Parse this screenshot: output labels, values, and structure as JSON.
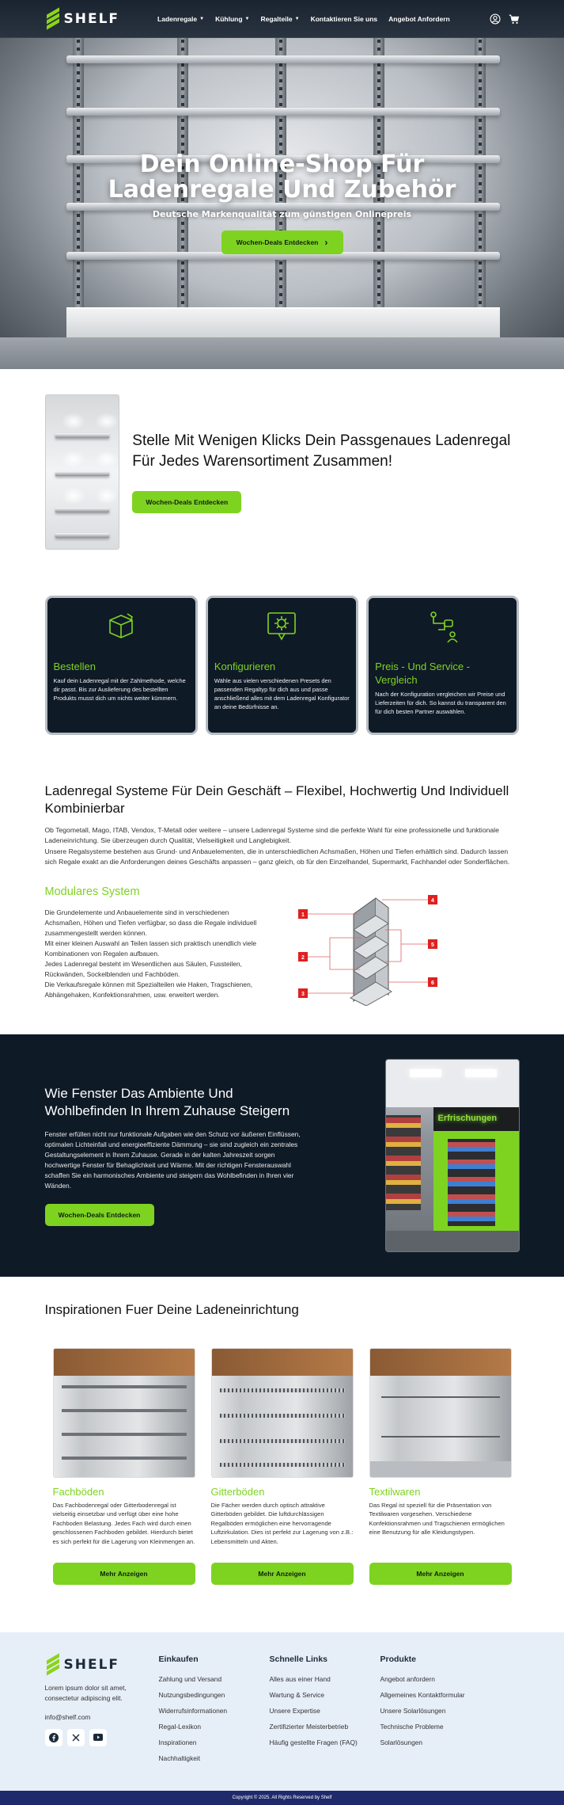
{
  "brand": {
    "name": "SHELF",
    "accent": "#7ed321",
    "dark": "#0f1a27"
  },
  "nav": {
    "items": [
      {
        "label": "Ladenregale",
        "dropdown": true
      },
      {
        "label": "Kühlung",
        "dropdown": true
      },
      {
        "label": "Regalteile",
        "dropdown": true
      },
      {
        "label": "Kontaktieren Sie uns",
        "dropdown": false
      },
      {
        "label": "Angebot Anfordern",
        "dropdown": false
      }
    ],
    "icons": [
      "user-icon",
      "cart-icon"
    ]
  },
  "hero": {
    "title_line1": "Dein Online-Shop Für",
    "title_line2": "Ladenregale Und Zubehör",
    "subtitle": "Deutsche Markenqualität zum günstigen Onlinepreis",
    "button": "Wochen-Deals Entdecken"
  },
  "intro": {
    "title": "Stelle Mit Wenigen Klicks Dein Passgenaues Ladenregal Für Jedes Warensortiment Zusammen!",
    "button": "Wochen-Deals Entdecken"
  },
  "cards": [
    {
      "icon": "box-icon",
      "title": "Bestellen",
      "text": "Kauf dein Ladenregal mit der Zahlmethode, welche dir passt. Bis zur Auslieferung des bestellten Produkts musst dich um nichts weiter kümmern."
    },
    {
      "icon": "gear-screen-icon",
      "title": "Konfigurieren",
      "text": "Wähle aus vielen verschiedenen Presets den passenden Regaltyp für dich aus und passe anschließend alles mit dem Ladenregal Konfigurator an deine Bedürfnisse an."
    },
    {
      "icon": "flow-person-icon",
      "title": "Preis - Und Service - Vergleich",
      "text": "Nach der Konfiguration vergleichen wir Preise und Lieferzeiten für dich. So kannst du transparent den für dich besten Partner auswählen."
    }
  ],
  "systems": {
    "title": "Ladenregal Systeme Für Dein Geschäft – Flexibel, Hochwertig Und Individuell Kombinierbar",
    "paragraph1": "Ob Tegometall, Mago, ITAB, Vendox, T-Metall oder weitere – unsere Ladenregal Systeme sind die perfekte Wahl für eine professionelle und funktionale Ladeneinrichtung. Sie überzeugen durch Qualität, Vielseitigkeit und Langlebigkeit.",
    "paragraph2": "Unsere Regalsysteme bestehen aus Grund- und Anbauelementen, die in unterschiedlichen Achsmaßen, Höhen und Tiefen erhältlich sind. Dadurch lassen sich Regale exakt an die Anforderungen deines Geschäfts anpassen – ganz gleich, ob für den Einzelhandel, Supermarkt, Fachhandel oder Sonderflächen.",
    "modular_title": "Modulares System",
    "modular_p1": "Die Grundelemente und Anbauelemente sind in verschiedenen Achsmaßen, Höhen und Tiefen verfügbar, so dass die Regale individuell zusammengestellt werden können.",
    "modular_p2": "Mit einer kleinen Auswahl an Teilen lassen sich praktisch unendlich viele Kombinationen von Regalen aufbauen.",
    "modular_p3": "Jedes Ladenregal besteht im Wesentlichen aus Säulen, Fussteilen, Rückwänden, Sockelblenden und Fachböden.",
    "modular_p4": "Die Verkaufsregale können mit Spezialteilen wie Haken, Tragschienen, Abhängehaken, Konfektionsrahmen, usw. erweitert werden.",
    "diagram_labels": [
      "1",
      "2",
      "3",
      "4",
      "5",
      "6"
    ]
  },
  "window": {
    "title": "Wie Fenster Das Ambiente Und Wohlbefinden In Ihrem Zuhause Steigern",
    "text": "Fenster erfüllen nicht nur funktionale Aufgaben wie den Schutz vor äußeren Einflüssen, optimalen Lichteinfall und energieeffiziente Dämmung – sie sind zugleich ein zentrales Gestaltungselement in Ihrem Zuhause. Gerade in der kalten Jahreszeit sorgen hochwertige Fenster für Behaglichkeit und Wärme. Mit der richtigen Fensterauswahl schaffen Sie ein harmonisches Ambiente und steigern das Wohlbefinden in Ihren vier Wänden.",
    "button": "Wochen-Deals Entdecken",
    "image_sign": "Erfrischungen"
  },
  "inspirations": {
    "title": "Inspirationen Fuer Deine Ladeneinrichtung",
    "items": [
      {
        "title": "Fachböden",
        "text": "Das Fachbodenregal oder Gitterbodenregal ist vielseitig einsetzbar und verfügt über eine hohe Fachboden Belastung. Jedes Fach wird durch einen geschlossenen Fachboden gebildet. Hierdurch bietet es sich perfekt für die Lagerung von Kleinmengen an.",
        "button": "Mehr Anzeigen"
      },
      {
        "title": "Gitterböden",
        "text": "Die Fächer werden durch optisch attraktive Gitterböden gebildet. Die luftdurchlässigen Regalböden ermöglichen eine hervorragende Luftzirkulation. Dies ist perfekt zur Lagerung von z.B.: Lebensmitteln und Akten.",
        "button": "Mehr Anzeigen"
      },
      {
        "title": "Textilwaren",
        "text": "Das Regal ist speziell für die Präsentation von Textilwaren vorgesehen. Verschiedene Konfektionsrahmen und Tragschienen ermöglichen eine Benutzung für alle Kleidungstypen.",
        "button": "Mehr Anzeigen"
      }
    ]
  },
  "footer": {
    "description": "Lorem ipsum dolor sit amet, consectetur adipiscing elit.",
    "email": "info@shelf.com",
    "socials": [
      "facebook-icon",
      "x-icon",
      "youtube-icon"
    ],
    "columns": [
      {
        "heading": "Einkaufen",
        "links": [
          "Zahlung und Versand",
          "Nutzungsbedingungen",
          "Widerrufsinformationen",
          "Regal-Lexikon",
          "Inspirationen",
          "Nachhaltigkeit"
        ]
      },
      {
        "heading": "Schnelle Links",
        "links": [
          "Alles aus einer Hand",
          "Wartung & Service",
          "Unsere Expertise",
          "Zertifizierter Meisterbetrieb",
          "Häufig gestellte Fragen (FAQ)"
        ]
      },
      {
        "heading": "Produkte",
        "links": [
          "Angebot anfordern",
          "Allgemeines Kontaktformular",
          "Unsere Solarlösungen",
          "Technische Probleme",
          "Solarlösungen"
        ]
      }
    ],
    "copyright": "Copyright © 2025. All Rights Reserved by Shelf"
  }
}
